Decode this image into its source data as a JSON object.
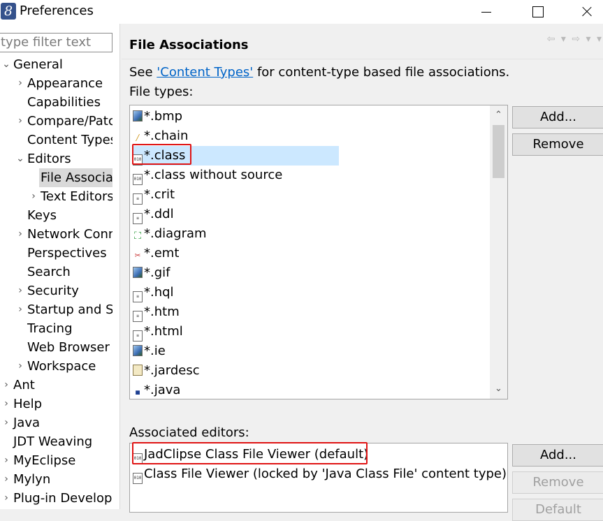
{
  "window": {
    "title": "Preferences",
    "app_icon_glyph": "8"
  },
  "filter": {
    "placeholder": "type filter text"
  },
  "tree": [
    {
      "label": "General",
      "depth": 0,
      "twisty": "expanded"
    },
    {
      "label": "Appearance",
      "depth": 1,
      "twisty": "collapsed"
    },
    {
      "label": "Capabilities",
      "depth": 1,
      "twisty": "none"
    },
    {
      "label": "Compare/Patch",
      "depth": 1,
      "twisty": "collapsed"
    },
    {
      "label": "Content Types",
      "depth": 1,
      "twisty": "none"
    },
    {
      "label": "Editors",
      "depth": 1,
      "twisty": "expanded"
    },
    {
      "label": "File Associations",
      "depth": 2,
      "twisty": "none",
      "selected": true
    },
    {
      "label": "Text Editors",
      "depth": 2,
      "twisty": "collapsed"
    },
    {
      "label": "Keys",
      "depth": 1,
      "twisty": "none"
    },
    {
      "label": "Network Connections",
      "depth": 1,
      "twisty": "collapsed"
    },
    {
      "label": "Perspectives",
      "depth": 1,
      "twisty": "none"
    },
    {
      "label": "Search",
      "depth": 1,
      "twisty": "none"
    },
    {
      "label": "Security",
      "depth": 1,
      "twisty": "collapsed"
    },
    {
      "label": "Startup and Shutdown",
      "depth": 1,
      "twisty": "collapsed"
    },
    {
      "label": "Tracing",
      "depth": 1,
      "twisty": "none"
    },
    {
      "label": "Web Browser",
      "depth": 1,
      "twisty": "none"
    },
    {
      "label": "Workspace",
      "depth": 1,
      "twisty": "collapsed"
    },
    {
      "label": "Ant",
      "depth": 0,
      "twisty": "collapsed"
    },
    {
      "label": "Help",
      "depth": 0,
      "twisty": "collapsed"
    },
    {
      "label": "Java",
      "depth": 0,
      "twisty": "collapsed"
    },
    {
      "label": "JDT Weaving",
      "depth": 0,
      "twisty": "none"
    },
    {
      "label": "MyEclipse",
      "depth": 0,
      "twisty": "collapsed"
    },
    {
      "label": "Mylyn",
      "depth": 0,
      "twisty": "collapsed"
    },
    {
      "label": "Plug-in Development",
      "depth": 0,
      "twisty": "collapsed"
    }
  ],
  "page": {
    "title": "File Associations",
    "see_prefix": "See ",
    "see_link": "'Content Types'",
    "see_suffix": " for content-type based file associations.",
    "file_types_label": "File types:",
    "associated_editors_label": "Associated editors:"
  },
  "file_types": [
    {
      "label": "*.bmp",
      "icon": "image-file-icon",
      "kind": "img"
    },
    {
      "label": "*.chain",
      "icon": "chain-file-icon",
      "kind": "chain"
    },
    {
      "label": "*.class",
      "icon": "class-file-icon",
      "kind": "bin",
      "selected": true
    },
    {
      "label": "*.class without source",
      "icon": "class-file-icon",
      "kind": "bin"
    },
    {
      "label": "*.crit",
      "icon": "crit-file-icon",
      "kind": "txt"
    },
    {
      "label": "*.ddl",
      "icon": "ddl-file-icon",
      "kind": "txt"
    },
    {
      "label": "*.diagram",
      "icon": "diagram-file-icon",
      "kind": "diagram"
    },
    {
      "label": "*.emt",
      "icon": "emt-file-icon",
      "kind": "emt"
    },
    {
      "label": "*.gif",
      "icon": "image-file-icon",
      "kind": "img"
    },
    {
      "label": "*.hql",
      "icon": "hql-file-icon",
      "kind": "txt"
    },
    {
      "label": "*.htm",
      "icon": "html-file-icon",
      "kind": "txt"
    },
    {
      "label": "*.html",
      "icon": "html-file-icon",
      "kind": "txt"
    },
    {
      "label": "*.ie",
      "icon": "image-file-icon",
      "kind": "img"
    },
    {
      "label": "*.jardesc",
      "icon": "jar-file-icon",
      "kind": "jar"
    },
    {
      "label": "*.java",
      "icon": "java-file-icon",
      "kind": "java"
    }
  ],
  "associated_editors": [
    {
      "label": "JadClipse Class File Viewer (default)",
      "icon": "class-file-icon"
    },
    {
      "label": "Class File Viewer (locked by 'Java Class File' content type)",
      "icon": "class-file-icon"
    }
  ],
  "buttons": {
    "types_add": "Add...",
    "types_remove": "Remove",
    "editors_add": "Add...",
    "editors_remove": "Remove",
    "editors_default": "Default"
  },
  "nav_arrows": "⇦ ▾ ⇨ ▾ ▾",
  "colors": {
    "selection": "#cce8ff",
    "tree_selection": "#d9d9d9",
    "link": "#0064c8",
    "highlight": "#e01414"
  }
}
